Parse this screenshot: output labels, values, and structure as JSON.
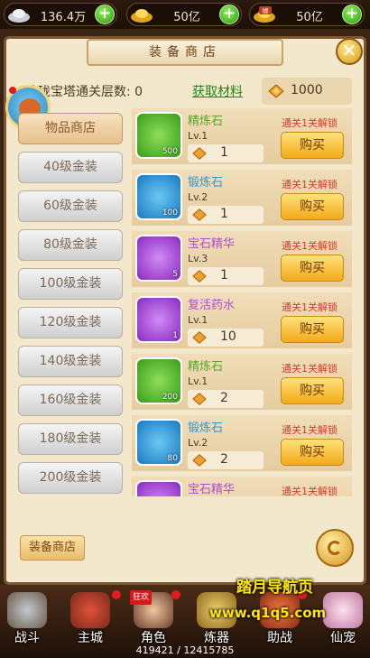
{
  "top_bar": {
    "silver": "136.4万",
    "gold": "50亿",
    "bound_gold": "50亿",
    "bound_label": "绑"
  },
  "header": {
    "title": "装备商店"
  },
  "info": {
    "floors_label": "玲珑宝塔通关层数:",
    "floors_value": "0",
    "get_materials": "获取材料",
    "material_count": "1000"
  },
  "sidebar": {
    "items": [
      {
        "label": "物品商店"
      },
      {
        "label": "40级金装"
      },
      {
        "label": "60级金装"
      },
      {
        "label": "80级金装"
      },
      {
        "label": "100级金装"
      },
      {
        "label": "120级金装"
      },
      {
        "label": "140级金装"
      },
      {
        "label": "160级金装"
      },
      {
        "label": "180级金装"
      },
      {
        "label": "200级金装"
      }
    ]
  },
  "shop": {
    "buy_label": "购买",
    "items": [
      {
        "name": "精炼石",
        "level": "Lv.1",
        "count": "500",
        "price": "1",
        "lock": "通关1关解锁",
        "name_color": "#5aa62a",
        "bg": "#4caf2a"
      },
      {
        "name": "锻炼石",
        "level": "Lv.2",
        "count": "100",
        "price": "1",
        "lock": "通关1关解锁",
        "name_color": "#2a9ad6",
        "bg": "#2a8ed0"
      },
      {
        "name": "宝石精华",
        "level": "Lv.3",
        "count": "5",
        "price": "1",
        "lock": "通关1关解锁",
        "name_color": "#b24ad6",
        "bg": "#9a3ad0"
      },
      {
        "name": "复活药水",
        "level": "Lv.1",
        "count": "1",
        "price": "10",
        "lock": "通关1关解锁",
        "name_color": "#b24ad6",
        "bg": "#9a3ad0"
      },
      {
        "name": "精炼石",
        "level": "Lv.1",
        "count": "200",
        "price": "2",
        "lock": "通关1关解锁",
        "name_color": "#5aa62a",
        "bg": "#4caf2a"
      },
      {
        "name": "锻炼石",
        "level": "Lv.2",
        "count": "80",
        "price": "2",
        "lock": "通关1关解锁",
        "name_color": "#2a9ad6",
        "bg": "#2a8ed0"
      },
      {
        "name": "宝石精华",
        "level": "",
        "count": "",
        "price": "",
        "lock": "通关1关解锁",
        "name_color": "#b24ad6",
        "bg": "#9a3ad0"
      }
    ]
  },
  "footer": {
    "equip_shop": "装备商店"
  },
  "nav": {
    "items": [
      {
        "label": "战斗"
      },
      {
        "label": "主城"
      },
      {
        "label": "角色"
      },
      {
        "label": "炼器"
      },
      {
        "label": "助战"
      },
      {
        "label": "仙宠"
      }
    ],
    "role_badge": "狂欢",
    "exp": "419421 / 12415785"
  },
  "watermark": {
    "line1": "踏月导航页",
    "line2": "www.q1q5.com"
  }
}
